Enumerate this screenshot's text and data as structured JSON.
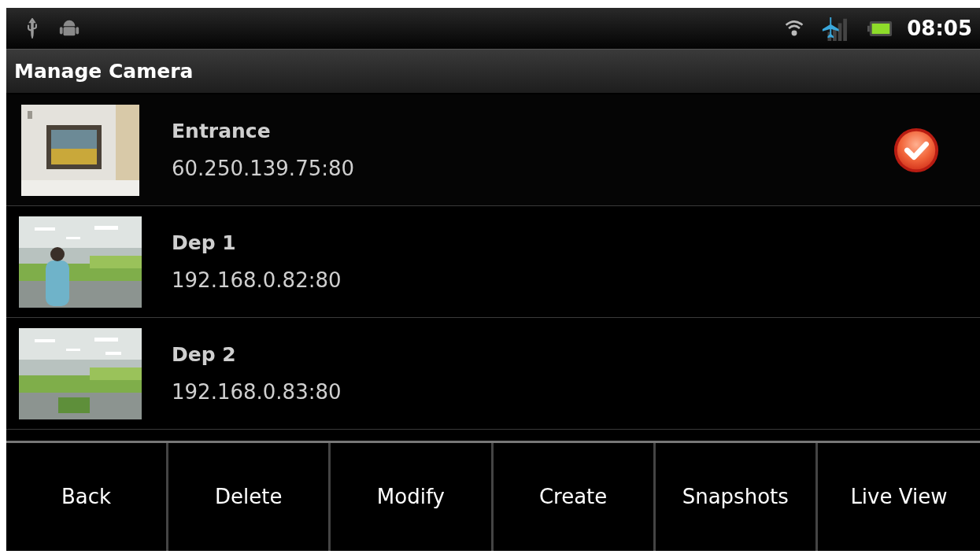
{
  "status_bar": {
    "time": "08:05"
  },
  "title": "Manage Camera",
  "cameras": [
    {
      "name": "Entrance",
      "address": "60.250.139.75:80",
      "selected": true,
      "kind": "picture"
    },
    {
      "name": "Dep 1",
      "address": "192.168.0.82:80",
      "selected": false,
      "kind": "picture"
    },
    {
      "name": "Dep 2",
      "address": "192.168.0.83:80",
      "selected": false,
      "kind": "picture"
    }
  ],
  "menu": [
    "Back",
    "Delete",
    "Modify",
    "Create",
    "Snapshots",
    "Live View"
  ]
}
